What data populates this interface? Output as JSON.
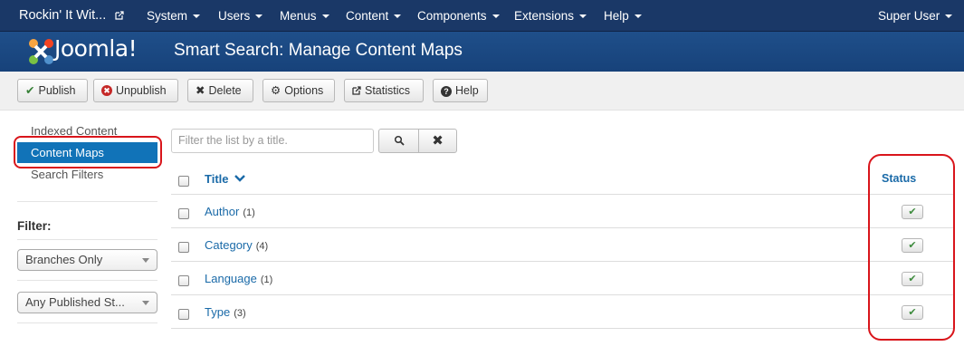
{
  "topnav": {
    "site_name": "Rockin' It Wit...",
    "menus": [
      "System",
      "Users",
      "Menus",
      "Content",
      "Components",
      "Extensions",
      "Help"
    ],
    "user": "Super User"
  },
  "header": {
    "logo_text": "Joomla!",
    "page_title": "Smart Search: Manage Content Maps"
  },
  "toolbar": {
    "publish": "Publish",
    "unpublish": "Unpublish",
    "delete": "Delete",
    "options": "Options",
    "statistics": "Statistics",
    "help": "Help"
  },
  "sidebar": {
    "items": [
      {
        "label": "Indexed Content",
        "active": false
      },
      {
        "label": "Content Maps",
        "active": true
      },
      {
        "label": "Search Filters",
        "active": false
      }
    ],
    "filter_label": "Filter:",
    "filter_branches": "Branches Only",
    "filter_published": "Any Published St..."
  },
  "search": {
    "placeholder": "Filter the list by a title."
  },
  "table": {
    "col_title": "Title",
    "col_status": "Status",
    "rows": [
      {
        "title": "Author",
        "count": "(1)",
        "published": true
      },
      {
        "title": "Category",
        "count": "(4)",
        "published": true
      },
      {
        "title": "Language",
        "count": "(1)",
        "published": true
      },
      {
        "title": "Type",
        "count": "(3)",
        "published": true
      }
    ]
  },
  "colors": {
    "nav_bg": "#1a3867",
    "header_bg": "#17427a",
    "active_item": "#1173b8",
    "link": "#1a6aa8",
    "highlight": "#d9151b"
  },
  "icons": {
    "publish": "check-icon",
    "unpublish": "unpublish-icon",
    "delete": "x-icon",
    "options": "gear-icon",
    "statistics": "external-icon",
    "help": "help-icon",
    "search": "search-icon",
    "clear": "clear-icon",
    "sort": "chevron-down-icon"
  }
}
